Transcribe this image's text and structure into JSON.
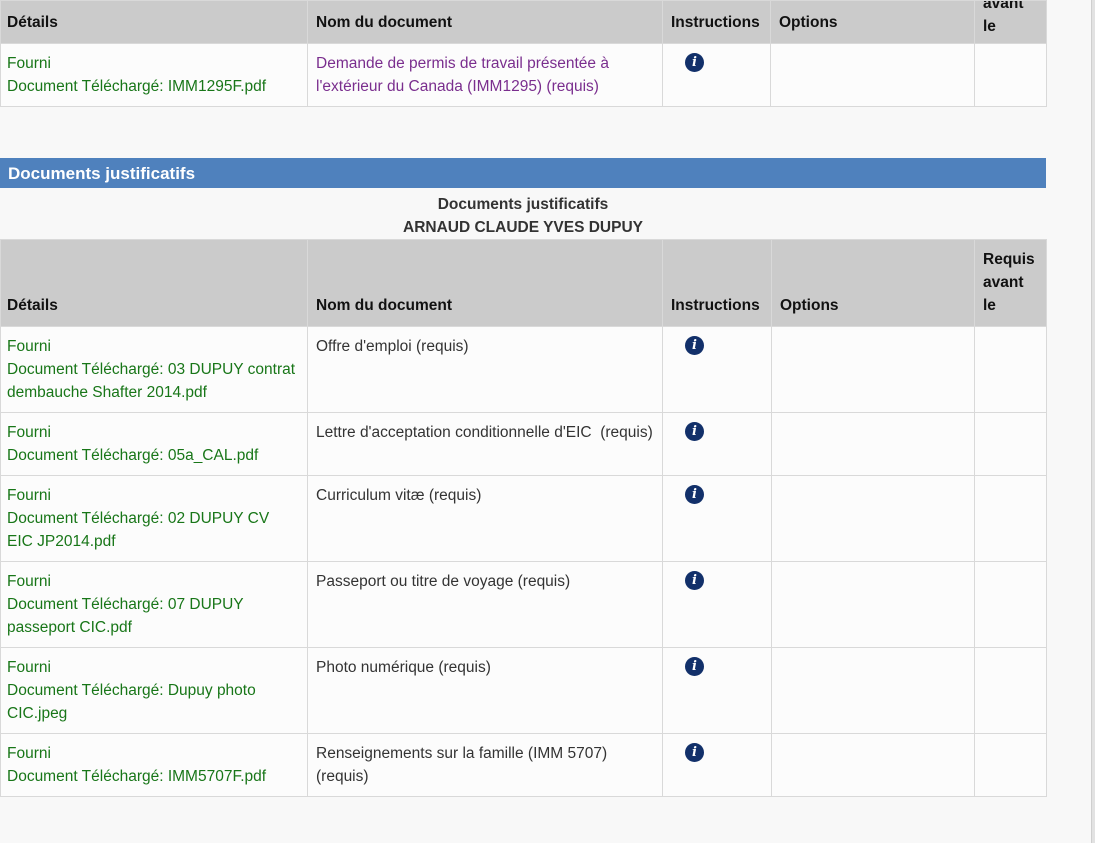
{
  "columns": {
    "details": "Détails",
    "document_name": "Nom du document",
    "instructions": "Instructions",
    "options": "Options",
    "required_before": "Requis avant le"
  },
  "top_table": {
    "header_clipped_text": "avant\nle",
    "row": {
      "status": "Fourni",
      "uploaded": "Document Téléchargé: IMM1295F.pdf",
      "document": "Demande de permis de travail présentée à l'extérieur du Canada (IMM1295)  (requis)"
    }
  },
  "section": {
    "title": "Documents justificatifs",
    "subtitle": "Documents justificatifs",
    "person": "ARNAUD CLAUDE YVES DUPUY"
  },
  "supporting_rows": [
    {
      "status": "Fourni",
      "uploaded": "Document Téléchargé: 03 DUPUY contrat dembauche Shafter 2014.pdf",
      "document": "Offre d'emploi  (requis)"
    },
    {
      "status": "Fourni",
      "uploaded": "Document Téléchargé: 05a_CAL.pdf",
      "document": "Lettre d'acceptation conditionnelle d'EIC  (requis)"
    },
    {
      "status": "Fourni",
      "uploaded": "Document Téléchargé: 02 DUPUY CV EIC JP2014.pdf",
      "document": "Curriculum vitæ  (requis)"
    },
    {
      "status": "Fourni",
      "uploaded": "Document Téléchargé: 07 DUPUY passeport CIC.pdf",
      "document": "Passeport ou titre de voyage  (requis)"
    },
    {
      "status": "Fourni",
      "uploaded": "Document Téléchargé: Dupuy photo CIC.jpeg",
      "document": "Photo numérique  (requis)"
    },
    {
      "status": "Fourni",
      "uploaded": "Document Téléchargé: IMM5707F.pdf",
      "document": "Renseignements sur la famille (IMM 5707)  (requis)"
    }
  ],
  "icons": {
    "instructions": "info-icon",
    "info_color": "#12306a"
  },
  "colors": {
    "header_bar": "#4f81bd",
    "status_text": "#187618",
    "link_text": "#7a2e8e",
    "table_header": "#cbcbcb"
  }
}
